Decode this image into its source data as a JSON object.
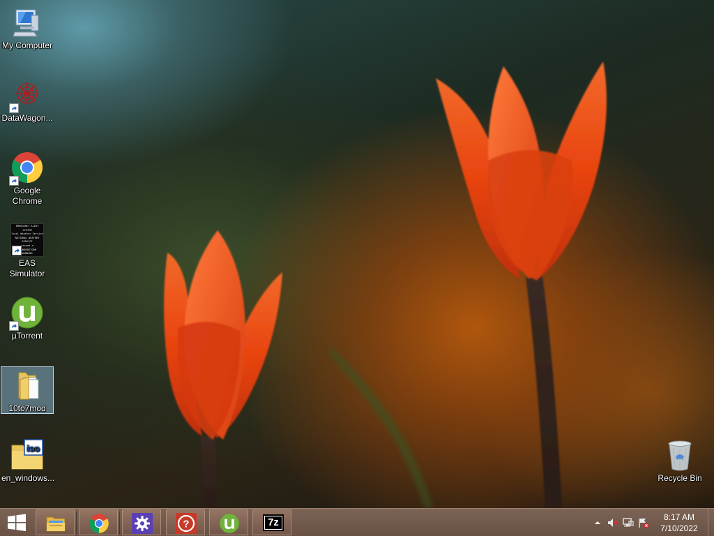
{
  "desktop": {
    "icons": [
      {
        "label": "My Computer",
        "icon": "computer-icon"
      },
      {
        "label": "DataWagon...",
        "icon": "datawagon-icon"
      },
      {
        "label": "Google Chrome",
        "icon": "chrome-icon"
      },
      {
        "label": "EAS Simulator",
        "icon": "eas-simulator-icon"
      },
      {
        "label": "µTorrent",
        "icon": "utorrent-icon"
      },
      {
        "label": "10to7mod",
        "icon": "folder-icon",
        "selected": true
      },
      {
        "label": "en_windows...",
        "icon": "iso-folder-icon"
      },
      {
        "label": "Recycle Bin",
        "icon": "recycle-bin-icon"
      }
    ],
    "eas_thumbnail_lines": [
      "EMERGENCY ALERT SYSTEM",
      "local Weather Service",
      "NATIONAL WEATHER SERVICE",
      "issued a",
      "THUNDERSTORM",
      "WARNING"
    ]
  },
  "taskbar": {
    "start_icon": "windows-logo-icon",
    "pinned": [
      {
        "name": "file-explorer",
        "icon": "file-explorer-icon"
      },
      {
        "name": "chrome",
        "icon": "chrome-icon"
      },
      {
        "name": "settings",
        "icon": "gear-icon"
      },
      {
        "name": "help",
        "icon": "help-icon",
        "glyph": "?"
      },
      {
        "name": "utorrent",
        "icon": "utorrent-icon"
      },
      {
        "name": "7zip",
        "icon": "7zip-icon",
        "glyph": "7z"
      }
    ],
    "tray": {
      "overflow_icon": "chevron-up-icon",
      "volume_icon": "volume-muted-icon",
      "network_icon": "network-icon",
      "action_center_icon": "action-center-flag-icon"
    },
    "clock": {
      "time": "8:17 AM",
      "date": "7/10/2022"
    }
  },
  "colors": {
    "taskbar": "#6b5144",
    "tulip": "#e8440f",
    "selection": "#99c9ef"
  }
}
